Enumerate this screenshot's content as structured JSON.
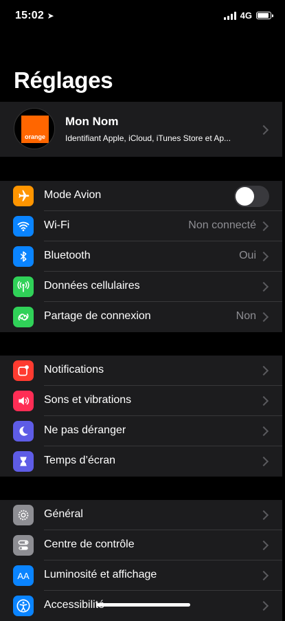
{
  "status": {
    "time": "15:02",
    "network": "4G"
  },
  "page": {
    "title": "Réglages"
  },
  "profile": {
    "avatar_text": "orange",
    "name": "Mon Nom",
    "subtitle": "Identifiant Apple, iCloud, iTunes Store et Ap..."
  },
  "groups": [
    {
      "rows": [
        {
          "label": "Mode Avion",
          "icon": "airplane-icon",
          "color": "#ff9500",
          "toggle": true,
          "toggle_on": false
        },
        {
          "label": "Wi-Fi",
          "value": "Non connecté",
          "icon": "wifi-icon",
          "color": "#0a84ff"
        },
        {
          "label": "Bluetooth",
          "value": "Oui",
          "icon": "bluetooth-icon",
          "color": "#0a84ff"
        },
        {
          "label": "Données cellulaires",
          "icon": "antenna-icon",
          "color": "#30d158"
        },
        {
          "label": "Partage de connexion",
          "value": "Non",
          "icon": "hotspot-icon",
          "color": "#30d158"
        }
      ]
    },
    {
      "rows": [
        {
          "label": "Notifications",
          "icon": "notifications-icon",
          "color": "#ff3b30"
        },
        {
          "label": "Sons et vibrations",
          "icon": "speaker-icon",
          "color": "#ff2d55"
        },
        {
          "label": "Ne pas déranger",
          "icon": "moon-icon",
          "color": "#5e5ce6"
        },
        {
          "label": "Temps d’écran",
          "icon": "hourglass-icon",
          "color": "#5e5ce6"
        }
      ]
    },
    {
      "rows": [
        {
          "label": "Général",
          "icon": "gear-icon",
          "color": "#8e8e93"
        },
        {
          "label": "Centre de contrôle",
          "icon": "control-center-icon",
          "color": "#8e8e93"
        },
        {
          "label": "Luminosité et affichage",
          "icon": "display-icon",
          "color": "#0a84ff",
          "icon_text": "AA"
        },
        {
          "label": "Accessibilité",
          "icon": "accessibility-icon",
          "color": "#0a84ff"
        }
      ]
    }
  ]
}
